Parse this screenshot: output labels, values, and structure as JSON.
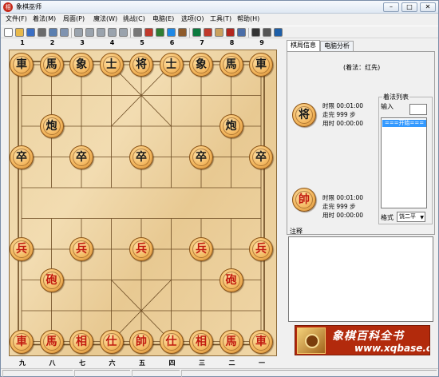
{
  "window": {
    "title": "象棋巫师",
    "app_icon": "相",
    "min": "–",
    "max": "□",
    "close": "✕"
  },
  "menu": [
    "文件(F)",
    "着法(M)",
    "局面(P)",
    "魔法(W)",
    "挑战(C)",
    "电脑(E)",
    "选项(O)",
    "工具(T)",
    "帮助(H)"
  ],
  "toolbar": [
    "new-icon",
    "open-icon",
    "save-icon",
    "print-icon",
    "copy-icon",
    "paste-icon",
    "first-move-icon",
    "prev-move-icon",
    "play-icon",
    "next-move-icon",
    "last-move-icon",
    "cut-icon",
    "delete-icon",
    "note-icon",
    "list-icon",
    "book-icon",
    "analyze-icon",
    "color-icon",
    "board-icon",
    "red-book-icon",
    "doc-icon",
    "timer-icon",
    "clock-icon",
    "info-icon"
  ],
  "board": {
    "files_top": [
      "1",
      "2",
      "3",
      "4",
      "5",
      "6",
      "7",
      "8",
      "9"
    ],
    "files_bottom": [
      "九",
      "八",
      "七",
      "六",
      "五",
      "四",
      "三",
      "二",
      "一"
    ],
    "river": "",
    "pieces": [
      {
        "side": "black",
        "char": "車",
        "col": 0,
        "row": 0
      },
      {
        "side": "black",
        "char": "馬",
        "col": 1,
        "row": 0
      },
      {
        "side": "black",
        "char": "象",
        "col": 2,
        "row": 0
      },
      {
        "side": "black",
        "char": "士",
        "col": 3,
        "row": 0
      },
      {
        "side": "black",
        "char": "将",
        "col": 4,
        "row": 0
      },
      {
        "side": "black",
        "char": "士",
        "col": 5,
        "row": 0
      },
      {
        "side": "black",
        "char": "象",
        "col": 6,
        "row": 0
      },
      {
        "side": "black",
        "char": "馬",
        "col": 7,
        "row": 0
      },
      {
        "side": "black",
        "char": "車",
        "col": 8,
        "row": 0
      },
      {
        "side": "black",
        "char": "炮",
        "col": 1,
        "row": 2
      },
      {
        "side": "black",
        "char": "炮",
        "col": 7,
        "row": 2
      },
      {
        "side": "black",
        "char": "卒",
        "col": 0,
        "row": 3
      },
      {
        "side": "black",
        "char": "卒",
        "col": 2,
        "row": 3
      },
      {
        "side": "black",
        "char": "卒",
        "col": 4,
        "row": 3
      },
      {
        "side": "black",
        "char": "卒",
        "col": 6,
        "row": 3
      },
      {
        "side": "black",
        "char": "卒",
        "col": 8,
        "row": 3
      },
      {
        "side": "red",
        "char": "兵",
        "col": 0,
        "row": 6
      },
      {
        "side": "red",
        "char": "兵",
        "col": 2,
        "row": 6
      },
      {
        "side": "red",
        "char": "兵",
        "col": 4,
        "row": 6
      },
      {
        "side": "red",
        "char": "兵",
        "col": 6,
        "row": 6
      },
      {
        "side": "red",
        "char": "兵",
        "col": 8,
        "row": 6
      },
      {
        "side": "red",
        "char": "砲",
        "col": 1,
        "row": 7
      },
      {
        "side": "red",
        "char": "砲",
        "col": 7,
        "row": 7
      },
      {
        "side": "red",
        "char": "車",
        "col": 0,
        "row": 9
      },
      {
        "side": "red",
        "char": "馬",
        "col": 1,
        "row": 9
      },
      {
        "side": "red",
        "char": "相",
        "col": 2,
        "row": 9
      },
      {
        "side": "red",
        "char": "仕",
        "col": 3,
        "row": 9
      },
      {
        "side": "red",
        "char": "帥",
        "col": 4,
        "row": 9
      },
      {
        "side": "red",
        "char": "仕",
        "col": 5,
        "row": 9
      },
      {
        "side": "red",
        "char": "相",
        "col": 6,
        "row": 9
      },
      {
        "side": "red",
        "char": "馬",
        "col": 7,
        "row": 9
      },
      {
        "side": "red",
        "char": "車",
        "col": 8,
        "row": 9
      }
    ]
  },
  "panel": {
    "tabs": [
      "棋局信息",
      "电脑分析"
    ],
    "move_by": "(着法：红先)",
    "black": {
      "piece": "将",
      "time_limit": "时限  00:01:00",
      "moves": "走完  999 步",
      "used": "用时  00:00:00"
    },
    "red": {
      "piece": "帥",
      "time_limit": "时限  00:01:00",
      "moves": "走完  999 步",
      "used": "用时  00:00:00"
    },
    "movelist": {
      "title": "着法列表",
      "input_label": "输入",
      "first_item": "===开始===",
      "format_label": "格式",
      "format_value": "饶二平"
    },
    "comment_label": "注释",
    "banner": {
      "title": "象棋百科全书",
      "url": "www.xqbase.com"
    }
  },
  "colors": {
    "red_piece": "#c11a0e",
    "black_piece": "#1a1a1a",
    "board": "#eed4a3",
    "selection": "#3399ff"
  }
}
